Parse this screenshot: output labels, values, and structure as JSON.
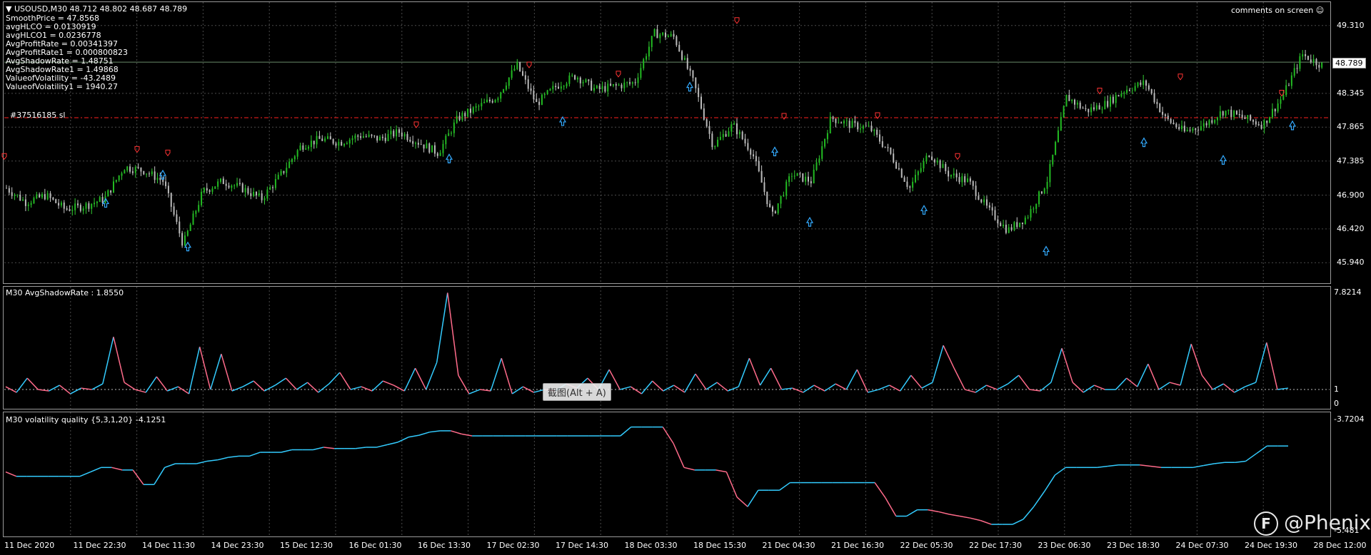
{
  "symbol_header": "USOUSD,M30  48.712 48.802 48.687 48.789",
  "comments_label": "comments on screen ☺",
  "info_lines": [
    "SmoothPrice = 47.8568",
    "avgHLCO = 0.0130919",
    "avgHLCO1 = 0.0236778",
    "AvgProfitRate  = 0.00341397",
    "AvgProfitRate1  = 0.000800823",
    "AvgShadowRate  = 1.48751",
    "AvgShadowRate1 = 1.49868",
    "ValueofVolatility = -43.2489",
    "ValueofVolatility1 = 1940.27"
  ],
  "order_label": "#37516185 sl",
  "current_price": "48.789",
  "main_price_ticks": [
    "49.310",
    "48.345",
    "47.865",
    "47.385",
    "46.900",
    "46.420",
    "45.940"
  ],
  "shadow_title": "M30 AvgShadowRate : 1.8550",
  "shadow_ticks": [
    "7.8214",
    "1",
    "0"
  ],
  "vol_title": "M30 volatility quality {5,3,1,20} -4.1251",
  "vol_ticks": [
    "-3.7204",
    "-5.481"
  ],
  "time_labels": [
    "11 Dec 2020",
    "11 Dec 22:30",
    "14 Dec 11:30",
    "14 Dec 23:30",
    "15 Dec 12:30",
    "16 Dec 01:30",
    "16 Dec 13:30",
    "17 Dec 02:30",
    "17 Dec 14:30",
    "18 Dec 03:30",
    "18 Dec 15:30",
    "21 Dec 04:30",
    "21 Dec 16:30",
    "22 Dec 05:30",
    "22 Dec 17:30",
    "23 Dec 06:30",
    "23 Dec 18:30",
    "24 Dec 07:30",
    "24 Dec 19:30",
    "28 Dec 12:00"
  ],
  "tooltip": "截图(Alt + A)",
  "watermark": "@Phenix",
  "watermark_logo": "F",
  "colors": {
    "background": "#000000",
    "candle_up": "#33cc33",
    "candle_down": "#c8c8c8",
    "grid": "#4a4a4a",
    "line_up": "#33ccff",
    "line_down": "#ff6b8a",
    "arrow_up": "#33aaff",
    "arrow_down": "#ff3333",
    "sl_line": "#ff2020",
    "price_line": "#6a8a6a"
  },
  "chart_data": [
    {
      "type": "candlestick",
      "title": "USOUSD,M30",
      "ylim": [
        45.7,
        49.55
      ],
      "price_path": [
        47.0,
        46.8,
        46.9,
        46.7,
        46.75,
        46.85,
        47.3,
        47.25,
        47.1,
        46.2,
        46.95,
        47.1,
        47.0,
        46.85,
        47.2,
        47.6,
        47.7,
        47.65,
        47.75,
        47.7,
        47.8,
        47.65,
        47.5,
        48.0,
        48.15,
        48.3,
        48.75,
        48.2,
        48.45,
        48.6,
        48.4,
        48.45,
        48.5,
        49.2,
        49.15,
        48.5,
        47.6,
        47.9,
        47.5,
        46.6,
        47.2,
        47.1,
        48.0,
        47.9,
        47.85,
        47.5,
        47.0,
        47.5,
        47.2,
        47.1,
        46.7,
        46.4,
        46.6,
        47.1,
        48.3,
        48.1,
        48.2,
        48.4,
        48.5,
        48.0,
        47.8,
        47.9,
        48.1,
        48.0,
        47.9,
        48.3,
        48.9,
        48.75
      ]
    },
    {
      "type": "line",
      "title": "M30 AvgShadowRate",
      "ylim": [
        0,
        7.8214
      ],
      "values": [
        1.2,
        0.8,
        1.8,
        1.0,
        0.9,
        1.3,
        0.7,
        1.1,
        1.0,
        1.4,
        4.7,
        1.5,
        1.0,
        0.8,
        1.9,
        0.9,
        1.2,
        0.7,
        4.0,
        1.0,
        3.5,
        0.9,
        1.2,
        1.6,
        0.9,
        1.3,
        1.8,
        1.0,
        1.5,
        0.8,
        1.4,
        2.2,
        1.0,
        1.2,
        0.9,
        1.6,
        1.3,
        0.9,
        2.5,
        1.0,
        2.9,
        7.8,
        2.0,
        0.7,
        1.0,
        0.9,
        3.2,
        0.7,
        1.2,
        0.8,
        1.0,
        0.9,
        1.4,
        1.1,
        1.8,
        1.0,
        2.4,
        1.0,
        1.2,
        0.7,
        1.6,
        0.9,
        1.3,
        0.8,
        2.1,
        1.0,
        1.5,
        0.9,
        1.2,
        3.2,
        1.3,
        2.5,
        1.0,
        1.1,
        0.8,
        1.3,
        0.9,
        1.4,
        1.0,
        2.4,
        0.8,
        1.0,
        1.3,
        0.9,
        2.0,
        1.1,
        1.5,
        4.1,
        2.5,
        1.0,
        0.8,
        1.3,
        1.0,
        1.4,
        2.0,
        1.0,
        0.9,
        1.5,
        3.9,
        1.5,
        0.8,
        1.3,
        1.0,
        1.0,
        1.8,
        1.2,
        2.8,
        1.0,
        1.5,
        1.3,
        4.2,
        2.0,
        1.0,
        1.4,
        0.8,
        1.2,
        1.5,
        4.3,
        1.0,
        1.1
      ]
    },
    {
      "type": "line",
      "title": "M30 volatility quality {5,3,1,20}",
      "ylim": [
        -5.481,
        -3.7204
      ],
      "values": [
        -4.55,
        -4.62,
        -4.62,
        -4.62,
        -4.62,
        -4.62,
        -4.62,
        -4.62,
        -4.55,
        -4.48,
        -4.48,
        -4.52,
        -4.52,
        -4.75,
        -4.75,
        -4.48,
        -4.42,
        -4.42,
        -4.42,
        -4.38,
        -4.36,
        -4.32,
        -4.3,
        -4.3,
        -4.24,
        -4.24,
        -4.24,
        -4.2,
        -4.2,
        -4.2,
        -4.16,
        -4.18,
        -4.18,
        -4.18,
        -4.16,
        -4.16,
        -4.12,
        -4.08,
        -4.0,
        -3.97,
        -3.92,
        -3.9,
        -3.9,
        -3.95,
        -3.98,
        -3.98,
        -3.98,
        -3.98,
        -3.98,
        -3.98,
        -3.98,
        -3.98,
        -3.98,
        -3.98,
        -3.98,
        -3.98,
        -3.98,
        -3.98,
        -3.98,
        -3.84,
        -3.84,
        -3.84,
        -3.84,
        -4.1,
        -4.48,
        -4.52,
        -4.52,
        -4.52,
        -4.55,
        -4.95,
        -5.1,
        -4.84,
        -4.84,
        -4.84,
        -4.72,
        -4.72,
        -4.72,
        -4.72,
        -4.72,
        -4.72,
        -4.72,
        -4.72,
        -4.72,
        -4.96,
        -5.25,
        -5.25,
        -5.15,
        -5.15,
        -5.18,
        -5.22,
        -5.25,
        -5.28,
        -5.32,
        -5.38,
        -5.38,
        -5.38,
        -5.3,
        -5.1,
        -4.86,
        -4.6,
        -4.48,
        -4.48,
        -4.48,
        -4.48,
        -4.46,
        -4.44,
        -4.44,
        -4.44,
        -4.46,
        -4.48,
        -4.48,
        -4.48,
        -4.48,
        -4.45,
        -4.42,
        -4.4,
        -4.4,
        -4.38,
        -4.26,
        -4.14,
        -4.14,
        -4.14
      ]
    }
  ]
}
